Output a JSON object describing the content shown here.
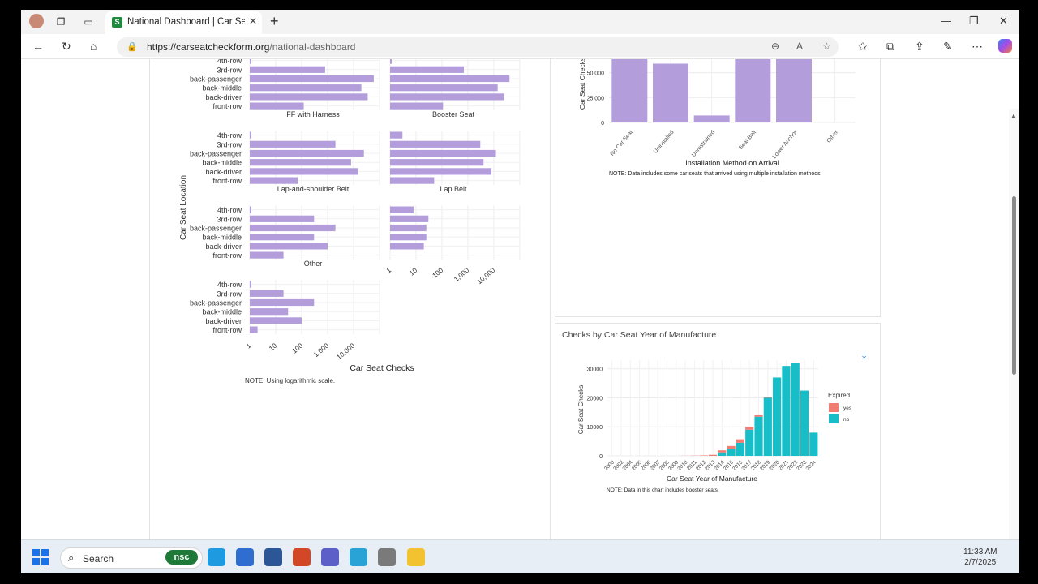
{
  "browser": {
    "tab_title": "National Dashboard | Car Seat Ch",
    "url_host": "https://carseatcheckform.org",
    "url_path": "/national-dashboard",
    "new_tab_symbol": "+"
  },
  "taskbar": {
    "search_label": "Search",
    "badge_label": "nsc",
    "time": "11:33 AM",
    "date": "2/7/2025"
  },
  "left_panel": {
    "chart_data": {
      "type": "bar",
      "orientation": "horizontal",
      "x_scale": "log",
      "xlabel": "Car Seat Checks",
      "ylabel": "Car Seat Location",
      "note": "NOTE: Using logarithmic scale.",
      "categories": [
        "4th-row",
        "3rd-row",
        "back-passenger",
        "back-middle",
        "back-driver",
        "front-row"
      ],
      "x_ticks": [
        "1",
        "10",
        "100",
        "1,000",
        "10,000"
      ],
      "color": "#b39ddb",
      "facets": [
        {
          "name": "",
          "values": [
            1,
            800,
            60000,
            20000,
            35000,
            120
          ]
        },
        {
          "name": "",
          "values": [
            1,
            700,
            40000,
            14000,
            25000,
            110
          ]
        },
        {
          "name": "FF with Harness",
          "values": [
            1,
            2000,
            25000,
            8000,
            15000,
            70
          ]
        },
        {
          "name": "Booster Seat",
          "values": [
            3,
            3000,
            12000,
            4000,
            8000,
            50
          ]
        },
        {
          "name": "Lap-and-shoulder Belt",
          "values": [
            1,
            300,
            2000,
            300,
            1000,
            20
          ]
        },
        {
          "name": "Lap Belt",
          "values": [
            8,
            30,
            25,
            25,
            20,
            0
          ]
        },
        {
          "name": "Other",
          "values": [
            1,
            20,
            300,
            30,
            100,
            2
          ]
        }
      ]
    }
  },
  "right_top_panel": {
    "chart_data": {
      "type": "bar",
      "xlabel": "Installation Method on Arrival",
      "ylabel": "Car Seat Checks",
      "note": "NOTE: Data includes some car seats that arrived using multiple installation methods",
      "categories": [
        "No Car Seat",
        "Uninstalled",
        "Unrestrained",
        "Seat Belt",
        "Lower Anchor",
        "Other"
      ],
      "values": [
        65000,
        59000,
        7000,
        70000,
        70000,
        0
      ],
      "y_ticks": [
        "0",
        "25,000",
        "50,000"
      ],
      "ylim": [
        0,
        70000
      ],
      "color": "#b39ddb"
    }
  },
  "right_bottom_panel": {
    "title": "Checks by Car Seat Year of Manufacture",
    "chart_data": {
      "type": "bar",
      "stacked": true,
      "xlabel": "Car Seat Year of Manufacture",
      "ylabel": "Car Seat Checks",
      "note": "NOTE: Data in this chart includes booster seats.",
      "categories": [
        "2000",
        "2002",
        "2004",
        "2005",
        "2006",
        "2007",
        "2008",
        "2009",
        "2010",
        "2011",
        "2012",
        "2013",
        "2014",
        "2015",
        "2016",
        "2017",
        "2018",
        "2019",
        "2020",
        "2021",
        "2022",
        "2023",
        "2024"
      ],
      "ylim": [
        0,
        33000
      ],
      "y_ticks": [
        "0",
        "10000",
        "20000",
        "30000"
      ],
      "legend_title": "Expired",
      "legend_position": "right",
      "series": [
        {
          "name": "yes",
          "color": "#f07c74",
          "values": [
            0,
            0,
            0,
            0,
            0,
            0,
            0,
            0,
            30,
            80,
            150,
            350,
            700,
            900,
            1200,
            1000,
            500,
            200,
            0,
            0,
            0,
            0,
            0
          ]
        },
        {
          "name": "no",
          "color": "#17bec8",
          "values": [
            0,
            0,
            0,
            0,
            0,
            0,
            0,
            0,
            0,
            0,
            0,
            0,
            0,
            1200,
            2500,
            4500,
            9000,
            13500,
            20000,
            27000,
            31000,
            32000,
            22500,
            8000
          ]
        }
      ]
    }
  }
}
